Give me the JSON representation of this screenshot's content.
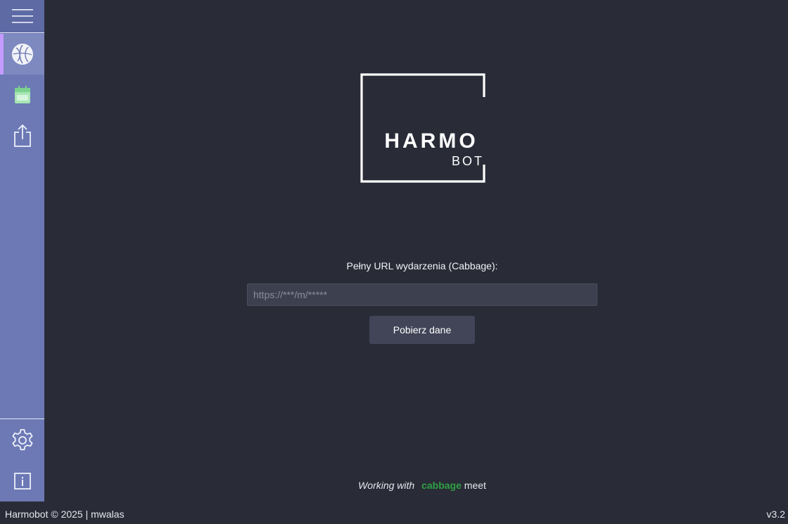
{
  "app": {
    "title": "Harmobot"
  },
  "logo": {
    "line1": "HARMO",
    "line2": "BOT"
  },
  "sidebar": {
    "items": [
      {
        "name": "menu",
        "icon": "hamburger-icon"
      },
      {
        "name": "cabbage",
        "icon": "cabbage-icon",
        "active": true
      },
      {
        "name": "calendar",
        "icon": "calendar-icon"
      },
      {
        "name": "export",
        "icon": "share-icon"
      },
      {
        "name": "settings",
        "icon": "gear-icon"
      },
      {
        "name": "info",
        "icon": "info-icon"
      }
    ],
    "accent": "#c49bff"
  },
  "form": {
    "label": "Pełny URL wydarzenia (Cabbage):",
    "url_placeholder": "https://***/m/*****",
    "url_value": "",
    "fetch_label": "Pobierz dane"
  },
  "working_with": {
    "prefix": "Working with",
    "brand": "cabbage",
    "suffix": "meet",
    "brand_color": "#2ea043"
  },
  "footer": {
    "left": "Harmobot © 2025 | mwalas",
    "version": "v3.2"
  }
}
